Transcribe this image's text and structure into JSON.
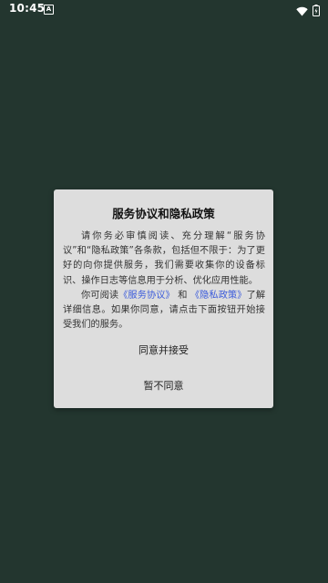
{
  "status_bar": {
    "time": "10:45",
    "notification_icon": "A",
    "wifi_icon": "wifi-icon",
    "battery_icon": "battery-icon"
  },
  "dialog": {
    "title": "服务协议和隐私政策",
    "para1": "请你务必审慎阅读、充分理解“服务协议”和“隐私政策”各条款，包括但不限于：为了更好的向你提供服务，我们需要收集你的设备标识、操作日志等信息用于分析、优化应用性能。",
    "para2_prefix": "你可阅读",
    "service_link": "《服务协议》",
    "para2_and": "和",
    "privacy_link": "《隐私政策》",
    "para2_suffix": "了解详细信息。如果你同意，请点击下面按钮开始接受我们的服务。",
    "agree_button": "同意并接受",
    "disagree_button": "暂不同意"
  },
  "colors": {
    "background": "#23362f",
    "dialog_bg": "#dddddd",
    "link": "#3b5bdb"
  }
}
